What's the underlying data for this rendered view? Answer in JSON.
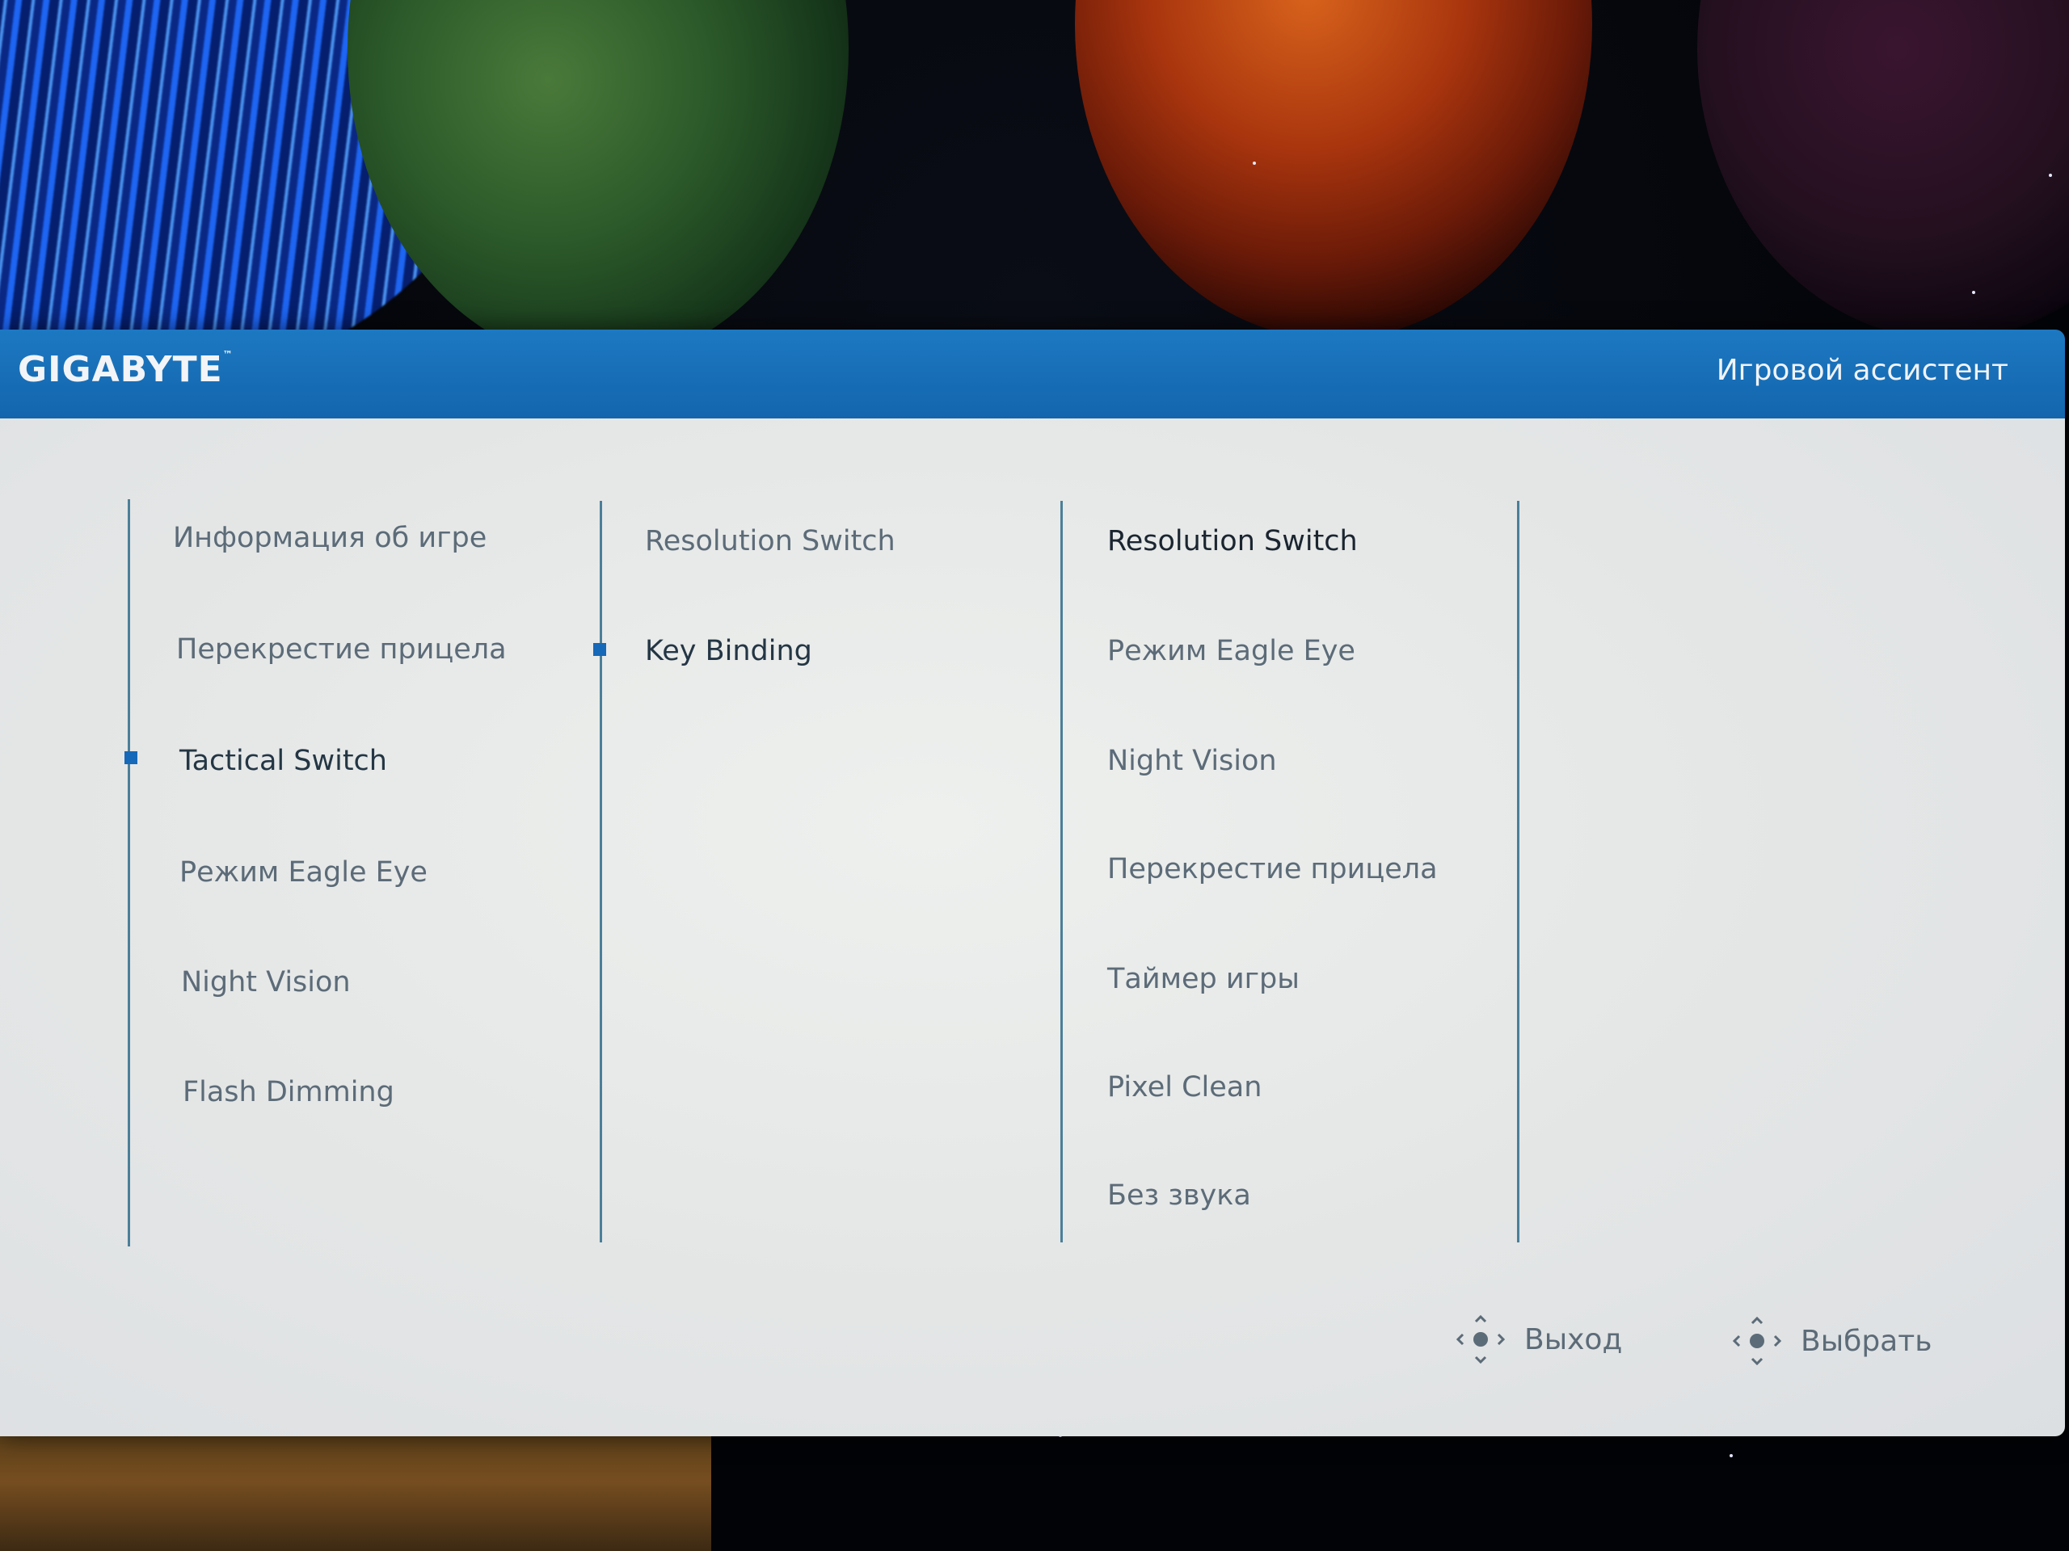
{
  "header": {
    "brand": "GIGABYTE",
    "title": "Игровой ассистент"
  },
  "columns": {
    "main": {
      "items": [
        "Информация об игре",
        "Перекрестие прицела",
        "Tactical Switch",
        "Режим Eagle Eye",
        "Night Vision",
        "Flash Dimming"
      ],
      "selected": "Tactical Switch"
    },
    "sub": {
      "items": [
        "Resolution Switch",
        "Key Binding"
      ],
      "selected": "Key Binding"
    },
    "options": {
      "items": [
        "Resolution Switch",
        "Режим Eagle Eye",
        "Night Vision",
        "Перекрестие прицела",
        "Таймер игры",
        "Pixel Clean",
        "Без звука"
      ],
      "selected": "Resolution Switch"
    }
  },
  "footer": {
    "exit_label": "Выход",
    "select_label": "Выбрать"
  },
  "colors": {
    "header_blue": "#1668b0",
    "marker_blue": "#1668b8",
    "divider": "#4b7f99"
  }
}
